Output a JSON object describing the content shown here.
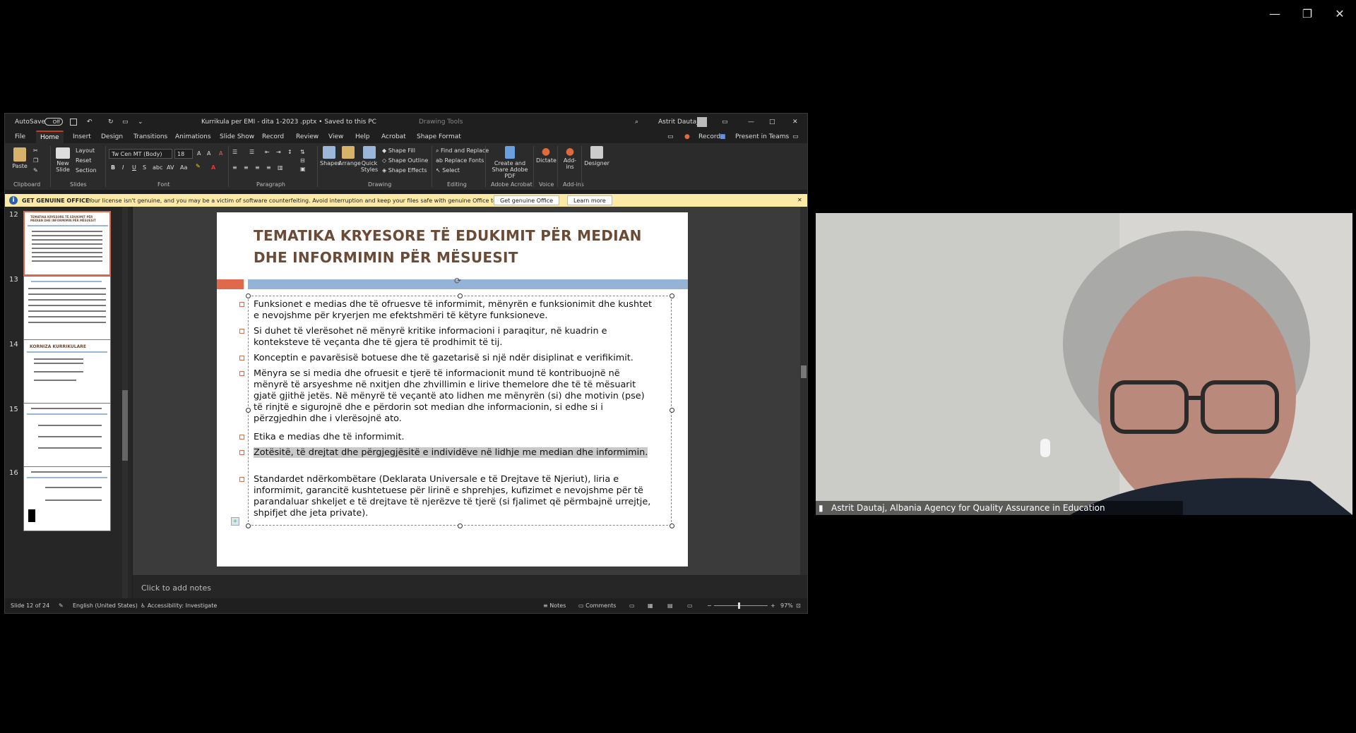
{
  "meeting": {
    "window_controls": {
      "minimize": "—",
      "restore": "❐",
      "close": "✕"
    },
    "participant": {
      "name_tag": "Astrit Dautaj, Albania Agency for Quality Assurance in Education"
    }
  },
  "ppt": {
    "titlebar": {
      "autosave_label": "AutoSave",
      "autosave_state": "Off",
      "document_title": "Kurrikula per EMI - dita 1-2023 .pptx • Saved to this PC",
      "contextual_tab": "Drawing Tools",
      "user_name": "Astrit Dautaj"
    },
    "menu": [
      "File",
      "Home",
      "Insert",
      "Design",
      "Transitions",
      "Animations",
      "Slide Show",
      "Record",
      "Review",
      "View",
      "Help",
      "Acrobat",
      "Shape Format"
    ],
    "menu_active": "Home",
    "menu_right": {
      "record": "Record",
      "present": "Present in Teams"
    },
    "ribbon": {
      "paste": "Paste",
      "new_slide": "New Slide",
      "layout": "Layout",
      "reset": "Reset",
      "section": "Section",
      "font_name": "Tw Cen MT (Body)",
      "font_size": "18",
      "shapes": "Shapes",
      "arrange": "Arrange",
      "quick_styles": "Quick Styles",
      "shape_fill": "Shape Fill",
      "shape_outline": "Shape Outline",
      "shape_effects": "Shape Effects",
      "find_replace": "Find and Replace",
      "replace_fonts": "Replace Fonts",
      "select": "Select",
      "create_share_pdf": "Create and Share Adobe PDF",
      "dictate": "Dictate",
      "addins": "Add-ins",
      "designer": "Designer",
      "groups": {
        "clipboard": "Clipboard",
        "slides": "Slides",
        "font": "Font",
        "paragraph": "Paragraph",
        "drawing": "Drawing",
        "editing": "Editing",
        "adobe": "Adobe Acrobat",
        "voice": "Voice",
        "addins": "Add-ins"
      }
    },
    "infobar": {
      "title": "GET GENUINE OFFICE",
      "message": "Your license isn't genuine, and you may be a victim of software counterfeiting. Avoid interruption and keep your files safe with genuine Office today.",
      "btn_genuine": "Get genuine Office",
      "btn_learn": "Learn more"
    },
    "thumbnails": [
      {
        "num": "12",
        "title": "TEMATIKA KRYESORE TË EDUKIMIT PËR MEDIAN DHE INFORMIMIN PËR MËSUESIT"
      },
      {
        "num": "13",
        "title": ""
      },
      {
        "num": "14",
        "title": "KORNIZA KURRIKULARE"
      },
      {
        "num": "15",
        "title": ""
      },
      {
        "num": "16",
        "title": ""
      }
    ],
    "slide": {
      "title": "TEMATIKA KRYESORE TË EDUKIMIT PËR MEDIAN DHE INFORMIMIN PËR MËSUESIT",
      "bullets": [
        "Funksionet e medias dhe të ofruesve të informimit, mënyrën e funksionimit dhe kushtet e nevojshme për kryerjen me efektshmëri të këtyre funksioneve.",
        "Si duhet të vlerësohet në mënyrë kritike informacioni i paraqitur, në kuadrin e konteksteve të veçanta dhe të gjera të prodhimit të tij.",
        "Konceptin e pavarësisë botuese dhe të gazetarisë si një ndër disiplinat e verifikimit.",
        "Mënyra se si media dhe ofruesit e tjerë të informacionit mund të kontribuojnë në mënyrë të arsyeshme në nxitjen dhe zhvillimin e lirive themelore dhe të të mësuarit gjatë gjithë jetës. Në mënyrë të veçantë ato lidhen me mënyrën (si) dhe motivin (pse) të rinjtë e sigurojnë dhe e përdorin sot median dhe informacionin, si edhe si i përzgjedhin dhe i vlerësojnë ato.",
        "Etika e medias  dhe të informimit.",
        "Zotësitë, të drejtat dhe përgjegjësitë  e individëve në lidhje me median dhe informimin.",
        "Standardet ndërkombëtare (Deklarata Universale e të Drejtave të Njeriut), liria e informimit, garancitë kushtetuese për lirinë e shprehjes, kufizimet e nevojshme për të parandaluar shkeljet e të drejtave të njerëzve të tjerë (si fjalimet që përmbajnë urrejtje, shpifjet dhe jeta private)."
      ]
    },
    "notes_placeholder": "Click to add notes",
    "status": {
      "slide_of": "Slide 12 of 24",
      "language": "English (United States)",
      "accessibility": "Accessibility: Investigate",
      "notes": "Notes",
      "comments": "Comments",
      "zoom": "97%"
    }
  }
}
